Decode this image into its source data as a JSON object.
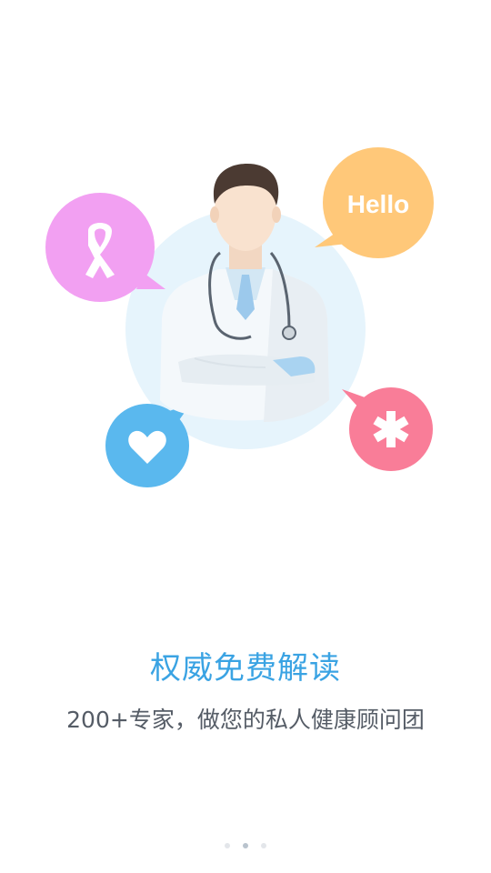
{
  "illustration": {
    "bubbles": [
      {
        "icon": "awareness-ribbon-icon",
        "color": "#f2a0f2"
      },
      {
        "text": "Hello",
        "color": "#ffc879"
      },
      {
        "icon": "heart-icon",
        "color": "#5ab8ee"
      },
      {
        "icon": "asterisk-icon",
        "color": "#f97d98"
      }
    ],
    "doctor": "doctor-illustration",
    "backdrop_color": "#e7f4fb"
  },
  "onboarding": {
    "title": "权威免费解读",
    "subtitle": "200+专家，做您的私人健康顾问团"
  },
  "pager": {
    "page_count": 3,
    "active_index": 1
  }
}
